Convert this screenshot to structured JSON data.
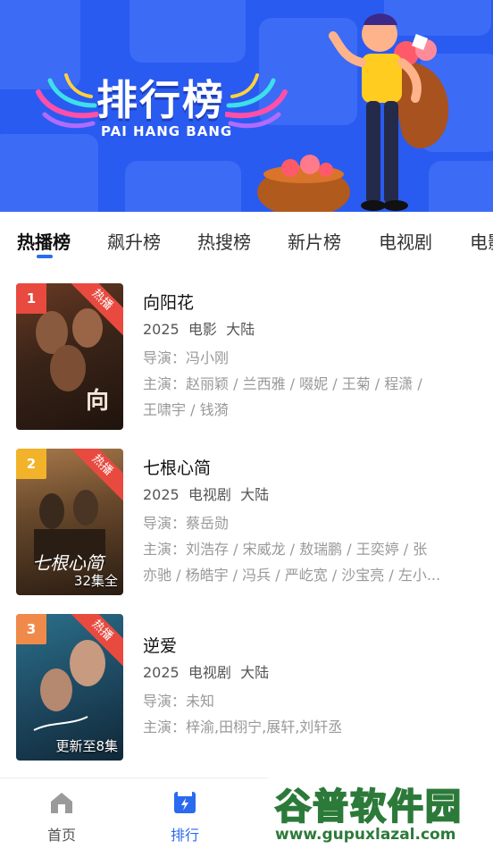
{
  "banner": {
    "title": "排行榜",
    "subtitle": "PAI HANG BANG"
  },
  "tabs": [
    {
      "label": "热播榜",
      "active": true
    },
    {
      "label": "飙升榜"
    },
    {
      "label": "热搜榜"
    },
    {
      "label": "新片榜"
    },
    {
      "label": "电视剧"
    },
    {
      "label": "电影"
    }
  ],
  "items": [
    {
      "rank": "1",
      "badge": "热播",
      "poster_text": "",
      "title": "向阳花",
      "year": "2025",
      "type": "电影",
      "region": "大陆",
      "director_label": "导演：",
      "director": "冯小刚",
      "cast_label": "主演：",
      "cast_line1": "赵丽颖 / 兰西雅 / 啜妮 / 王菊 / 程潇 /",
      "cast_line2": "王啸宇 / 钱漪"
    },
    {
      "rank": "2",
      "badge": "热播",
      "poster_text": "32集全",
      "title": "七根心简",
      "year": "2025",
      "type": "电视剧",
      "region": "大陆",
      "director_label": "导演：",
      "director": "蔡岳勋",
      "cast_label": "主演：",
      "cast_line1": "刘浩存 / 宋威龙 / 敖瑞鹏 / 王奕婷 / 张",
      "cast_line2": "亦驰 / 杨皓宇 / 冯兵 / 严屹宽 / 沙宝亮 / 左小..."
    },
    {
      "rank": "3",
      "badge": "热播",
      "poster_text": "更新至8集",
      "title": "逆爱",
      "year": "2025",
      "type": "电视剧",
      "region": "大陆",
      "director_label": "导演：",
      "director": "未知",
      "cast_label": "主演：",
      "cast_line1": "梓渝,田栩宁,展轩,刘轩丞",
      "cast_line2": ""
    }
  ],
  "nav": [
    {
      "label": "首页",
      "icon": "home-icon"
    },
    {
      "label": "排行",
      "icon": "ranking-icon",
      "active": true
    }
  ],
  "watermark": {
    "text": "谷普软件园",
    "url": "www.gupuxlazal.com"
  },
  "colors": {
    "banner_bg": "#2a5bf0",
    "accent": "#2a6af0",
    "rank1": "#e84a3f",
    "rank2": "#f2b32a",
    "rank3": "#f08a4b",
    "hot_badge": "#e84a3f"
  }
}
